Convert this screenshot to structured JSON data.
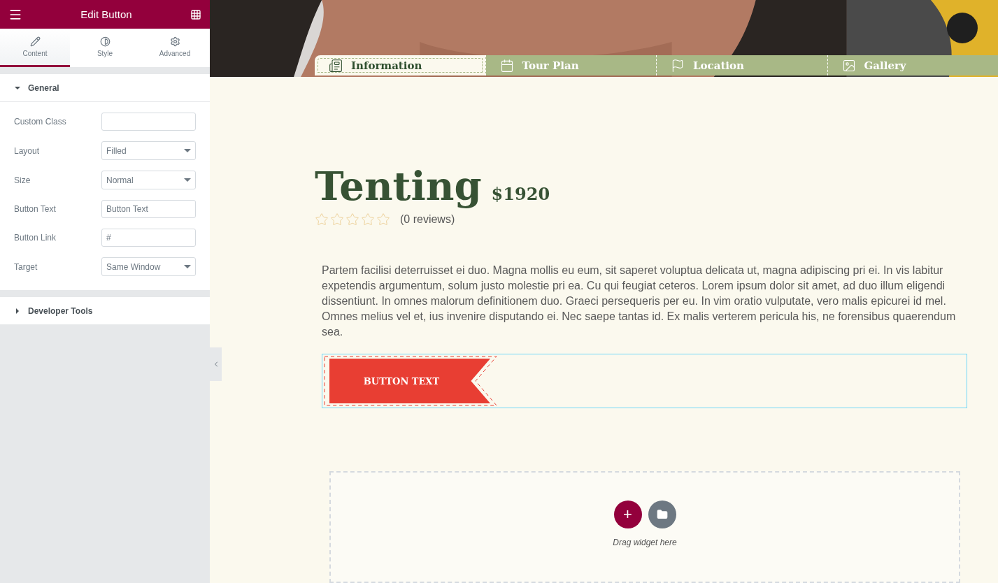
{
  "panel": {
    "title": "Edit Button",
    "tabs": [
      {
        "label": "Content",
        "selected": true
      },
      {
        "label": "Style",
        "selected": false
      },
      {
        "label": "Advanced",
        "selected": false
      }
    ],
    "sections": [
      {
        "title": "General",
        "expanded": true,
        "fields": [
          {
            "label": "Custom Class",
            "kind": "text"
          },
          {
            "label": "Layout",
            "kind": "select",
            "value": "Filled"
          },
          {
            "label": "Size",
            "kind": "select",
            "value": "Normal"
          },
          {
            "label": "Button Text",
            "kind": "text",
            "value": "Button Text"
          },
          {
            "label": "Button Link",
            "kind": "text",
            "value": "#"
          },
          {
            "label": "Target",
            "kind": "select",
            "value": "Same Window"
          }
        ]
      },
      {
        "title": "Developer Tools",
        "expanded": false
      }
    ]
  },
  "page": {
    "tabs": [
      {
        "label": "Information",
        "selected": true
      },
      {
        "label": "Tour Plan",
        "selected": false
      },
      {
        "label": "Location",
        "selected": false
      },
      {
        "label": "Gallery",
        "selected": false
      }
    ],
    "title": "Tenting",
    "price": "$1920",
    "stars": 0,
    "reviews": "(0 reviews)",
    "description": "Partem facilisi deterruisset ei duo. Magna mollis eu eum, sit saperet voluptua delicata ut, magna adipiscing pri ei. In vis labitur expetendis argumentum, solum justo molestie pri ea. Cu qui feugiat ceteros. Lorem ipsum dolor sit amet, ad duo illum eligendi dissentiunt. In omnes malorum definitionem duo. Graeci persequeris per eu. In vim oratio vulputate, vero malis epicurei id mel. Omnes melius vel et, ius invenire disputando ei. Nec saepe tantas id. Ex malis verterem pericula his, ne forensibus quaerendum sea.",
    "button": "BUTTON TEXT",
    "dropzone": {
      "hint": "Drag widget here",
      "add": "+"
    }
  }
}
